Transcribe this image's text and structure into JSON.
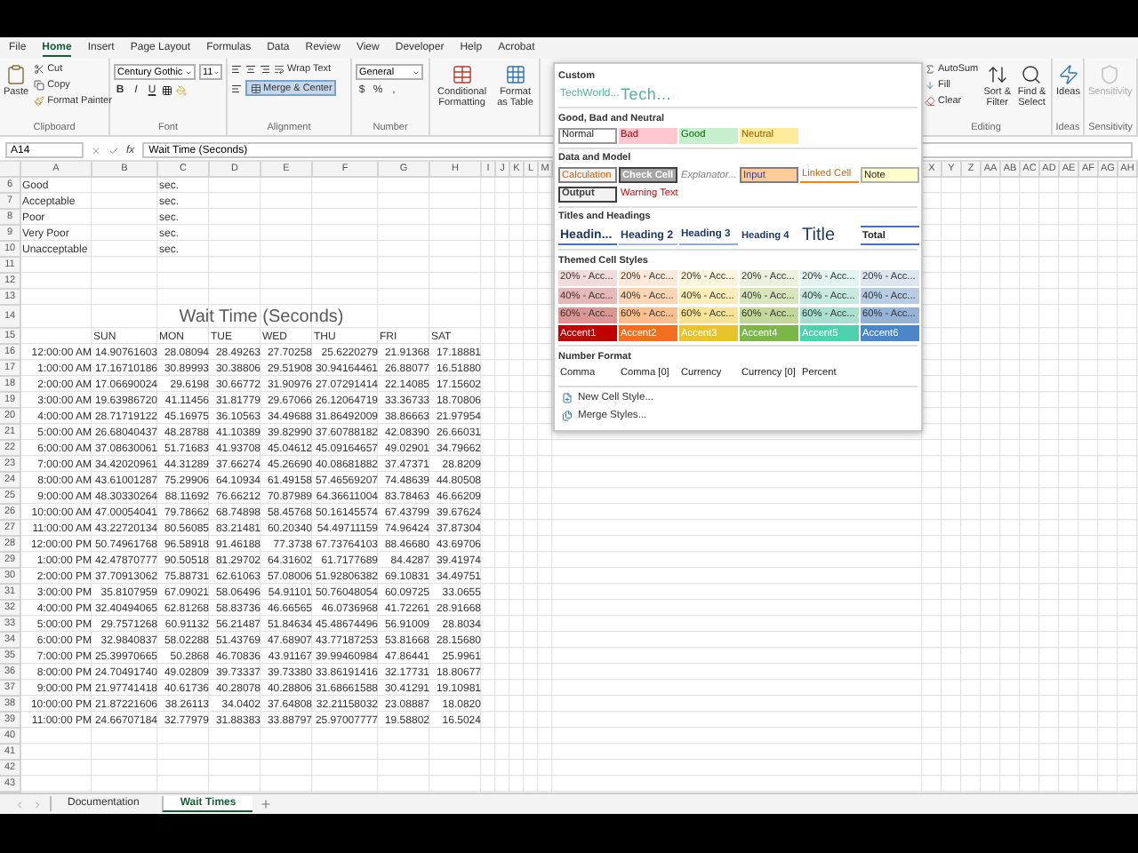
{
  "ribbon_tabs": [
    {
      "label": "File",
      "selected": false
    },
    {
      "label": "Home",
      "selected": true
    },
    {
      "label": "Insert",
      "selected": false
    },
    {
      "label": "Page Layout",
      "selected": false
    },
    {
      "label": "Formulas",
      "selected": false
    },
    {
      "label": "Data",
      "selected": false
    },
    {
      "label": "Review",
      "selected": false
    },
    {
      "label": "View",
      "selected": false
    },
    {
      "label": "Developer",
      "selected": false
    },
    {
      "label": "Help",
      "selected": false
    },
    {
      "label": "Acrobat",
      "selected": false
    }
  ],
  "ribbon": {
    "clipboard": {
      "label": "Clipboard",
      "paste": "Paste",
      "cut": "Cut",
      "copy": "Copy",
      "format_painter": "Format Painter"
    },
    "font": {
      "label": "Font",
      "name": "Century Gothic",
      "size": "11",
      "bold": "B",
      "italic": "I",
      "underline": "U"
    },
    "alignment": {
      "label": "Alignment",
      "wrap": "Wrap Text",
      "merge": "Merge & Center",
      "merge_on": true
    },
    "number": {
      "label": "Number",
      "format": "General",
      "currency": "$",
      "percent": "%",
      "comma": ","
    },
    "styles": [
      "Conditional Formatting",
      "Format as Table"
    ],
    "editing": {
      "label": "Editing",
      "autosum": "AutoSum",
      "fill": "Fill",
      "clear": "Clear",
      "sort": "Sort & Filter",
      "find": "Find & Select"
    },
    "ideas": {
      "label": "Ideas",
      "button": "Ideas"
    },
    "sensitivity": {
      "label": "Sensitivity",
      "button": "Sensitivity",
      "disabled": true
    }
  },
  "formula_bar": {
    "name_box": "A14",
    "fx": "fx",
    "formula": "Wait Time (Seconds)"
  },
  "columns_left": [
    "A",
    "B",
    "C",
    "D",
    "E",
    "F",
    "G",
    "H",
    "I",
    "J",
    "K",
    "L",
    "M"
  ],
  "columns_right": [
    "X",
    "Y",
    "Z",
    "AA",
    "AB",
    "AC",
    "AD",
    "AE",
    "AF",
    "AG",
    "AH"
  ],
  "rows": [
    {
      "number": "6",
      "kind": "rating",
      "label": "Good",
      "unit": "sec."
    },
    {
      "number": "7",
      "kind": "rating",
      "label": "Acceptable",
      "unit": "sec."
    },
    {
      "number": "8",
      "kind": "rating",
      "label": "Poor",
      "unit": "sec."
    },
    {
      "number": "9",
      "kind": "rating",
      "label": "Very Poor",
      "unit": "sec."
    },
    {
      "number": "10",
      "kind": "rating",
      "label": "Unacceptable",
      "unit": "sec."
    },
    {
      "number": "11",
      "kind": "empty"
    },
    {
      "number": "12",
      "kind": "empty"
    },
    {
      "number": "13",
      "kind": "empty"
    },
    {
      "number": "14",
      "kind": "title",
      "title": "Wait Time (Seconds)"
    },
    {
      "number": "15",
      "kind": "header",
      "headers": [
        "SUN",
        "MON",
        "TUE",
        "WED",
        "THU",
        "FRI",
        "SAT"
      ]
    },
    {
      "number": "16",
      "kind": "data",
      "time": "12:00:00 AM",
      "values": [
        "14.90761603",
        "28.08094",
        "28.49263",
        "27.70258",
        "25.6220279",
        "21.91368",
        "17.18881"
      ]
    },
    {
      "number": "17",
      "kind": "data",
      "time": "1:00:00 AM",
      "values": [
        "17.16710186",
        "30.89993",
        "30.38806",
        "29.51908",
        "30.94164461",
        "26.88077",
        "16.51880"
      ]
    },
    {
      "number": "18",
      "kind": "data",
      "time": "2:00:00 AM",
      "values": [
        "17.06690024",
        "29.6198",
        "30.66772",
        "31.90976",
        "27.07291414",
        "22.14085",
        "17.15602"
      ]
    },
    {
      "number": "19",
      "kind": "data",
      "time": "3:00:00 AM",
      "values": [
        "19.63986720",
        "41.11456",
        "31.81779",
        "29.67066",
        "26.12064719",
        "33.36733",
        "18.70806"
      ]
    },
    {
      "number": "20",
      "kind": "data",
      "time": "4:00:00 AM",
      "values": [
        "28.71719122",
        "45.16975",
        "36.10563",
        "34.49688",
        "31.86492009",
        "38.86663",
        "21.97954"
      ]
    },
    {
      "number": "21",
      "kind": "data",
      "time": "5:00:00 AM",
      "values": [
        "26.68040437",
        "48.28788",
        "41.10389",
        "39.82990",
        "37.60788182",
        "42.08390",
        "26.66031"
      ]
    },
    {
      "number": "22",
      "kind": "data",
      "time": "6:00:00 AM",
      "values": [
        "37.08630061",
        "51.71683",
        "41.93708",
        "45.04612",
        "45.09164657",
        "49.02901",
        "34.79662"
      ]
    },
    {
      "number": "23",
      "kind": "data",
      "time": "7:00:00 AM",
      "values": [
        "34.42020961",
        "44.31289",
        "37.66274",
        "45.26690",
        "40.08681882",
        "37.47371",
        "28.8209"
      ]
    },
    {
      "number": "24",
      "kind": "data",
      "time": "8:00:00 AM",
      "values": [
        "43.61001287",
        "75.29906",
        "64.10934",
        "61.49158",
        "57.46569207",
        "74.48639",
        "44.80508"
      ]
    },
    {
      "number": "25",
      "kind": "data",
      "time": "9:00:00 AM",
      "values": [
        "48.30330264",
        "88.11692",
        "76.66212",
        "70.87989",
        "64.36611004",
        "83.78463",
        "46.66209"
      ]
    },
    {
      "number": "26",
      "kind": "data",
      "time": "10:00:00 AM",
      "values": [
        "47.00054041",
        "79.78662",
        "68.74898",
        "58.45768",
        "50.16145574",
        "67.43799",
        "39.67624"
      ]
    },
    {
      "number": "27",
      "kind": "data",
      "time": "11:00:00 AM",
      "values": [
        "43.22720134",
        "80.56085",
        "83.21481",
        "60.20340",
        "54.49711159",
        "74.96424",
        "37.87304"
      ]
    },
    {
      "number": "28",
      "kind": "data",
      "time": "12:00:00 PM",
      "values": [
        "50.74961768",
        "96.58918",
        "91.46188",
        "77.3738",
        "67.73764103",
        "88.46680",
        "43.69706"
      ]
    },
    {
      "number": "29",
      "kind": "data",
      "time": "1:00:00 PM",
      "values": [
        "42.47870777",
        "90.50518",
        "81.29702",
        "64.31602",
        "61.7177689",
        "84.4287",
        "39.41974"
      ]
    },
    {
      "number": "30",
      "kind": "data",
      "time": "2:00:00 PM",
      "values": [
        "37.70913062",
        "75.88731",
        "62.61063",
        "57.08006",
        "51.92806382",
        "69.10831",
        "34.49751"
      ]
    },
    {
      "number": "31",
      "kind": "data",
      "time": "3:00:00 PM",
      "values": [
        "35.8107959",
        "67.09021",
        "58.06496",
        "54.91101",
        "50.76048054",
        "60.09725",
        "33.0655"
      ]
    },
    {
      "number": "32",
      "kind": "data",
      "time": "4:00:00 PM",
      "values": [
        "32.40494065",
        "62.81268",
        "58.83736",
        "46.66565",
        "46.0736968",
        "41.72261",
        "28.91668"
      ]
    },
    {
      "number": "33",
      "kind": "data",
      "time": "5:00:00 PM",
      "values": [
        "29.7571268",
        "60.91132",
        "56.21487",
        "51.84634",
        "45.48674496",
        "56.91009",
        "28.8034"
      ]
    },
    {
      "number": "34",
      "kind": "data",
      "time": "6:00:00 PM",
      "values": [
        "32.9840837",
        "58.02288",
        "51.43769",
        "47.68907",
        "43.77187253",
        "53.81668",
        "28.15680"
      ]
    },
    {
      "number": "35",
      "kind": "data",
      "time": "7:00:00 PM",
      "values": [
        "25.39970665",
        "50.2868",
        "46.70836",
        "43.91167",
        "39.99460984",
        "47.86441",
        "25.9961"
      ]
    },
    {
      "number": "36",
      "kind": "data",
      "time": "8:00:00 PM",
      "values": [
        "24.70491740",
        "49.02809",
        "39.73337",
        "39.73380",
        "33.86191416",
        "32.17731",
        "18.80677"
      ]
    },
    {
      "number": "37",
      "kind": "data",
      "time": "9:00:00 PM",
      "values": [
        "21.97741418",
        "40.61736",
        "40.28078",
        "40.28806",
        "31.68661588",
        "30.41291",
        "19.10981"
      ]
    },
    {
      "number": "38",
      "kind": "data",
      "time": "10:00:00 PM",
      "values": [
        "21.87221606",
        "38.26113",
        "34.0402",
        "37.64808",
        "32.21158032",
        "23.08887",
        "18.0820"
      ]
    },
    {
      "number": "39",
      "kind": "data",
      "time": "11:00:00 PM",
      "values": [
        "24.66707184",
        "32.77979",
        "31.88383",
        "33.88797",
        "25.97007777",
        "19.58802",
        "16.5024"
      ]
    },
    {
      "number": "40",
      "kind": "empty"
    },
    {
      "number": "41",
      "kind": "empty"
    },
    {
      "number": "42",
      "kind": "empty"
    },
    {
      "number": "43",
      "kind": "empty"
    }
  ],
  "sheet_tabs": [
    {
      "label": "Documentation",
      "selected": false
    },
    {
      "label": "Wait Times",
      "selected": true
    }
  ],
  "cell_styles": {
    "sections": [
      {
        "title": "Custom",
        "styles": [
          {
            "label": "TechWorld...",
            "kind": "custom_small"
          },
          {
            "label": "Tech...",
            "kind": "custom_large"
          }
        ]
      },
      {
        "title": "Good, Bad and Neutral",
        "styles": [
          {
            "label": "Normal",
            "kind": "normal"
          },
          {
            "label": "Bad",
            "kind": "bad"
          },
          {
            "label": "Good",
            "kind": "good"
          },
          {
            "label": "Neutral",
            "kind": "neutral"
          }
        ]
      },
      {
        "title": "Data and Model",
        "styles": [
          {
            "label": "Calculation",
            "kind": "calculation"
          },
          {
            "label": "Check Cell",
            "kind": "check"
          },
          {
            "label": "Explanator...",
            "kind": "explanatory"
          },
          {
            "label": "Input",
            "kind": "input"
          },
          {
            "label": "Linked Cell",
            "kind": "linked"
          },
          {
            "label": "Note",
            "kind": "note"
          },
          {
            "label": "Output",
            "kind": "output"
          },
          {
            "label": "Warning Text",
            "kind": "warning"
          }
        ]
      },
      {
        "title": "Titles and Headings",
        "styles": [
          {
            "label": "Headin...",
            "kind": "heading1"
          },
          {
            "label": "Heading 2",
            "kind": "heading2"
          },
          {
            "label": "Heading 3",
            "kind": "heading3"
          },
          {
            "label": "Heading 4",
            "kind": "heading4"
          },
          {
            "label": "Title",
            "kind": "title"
          },
          {
            "label": "Total",
            "kind": "total"
          }
        ]
      },
      {
        "title": "Themed Cell Styles",
        "styles": [
          {
            "label": "20% - Acc...",
            "kind": "tint",
            "color": "#f2dcdb"
          },
          {
            "label": "20% - Acc...",
            "kind": "tint",
            "color": "#fde9d9"
          },
          {
            "label": "20% - Acc...",
            "kind": "tint",
            "color": "#fdf6dc"
          },
          {
            "label": "20% - Acc...",
            "kind": "tint",
            "color": "#ebf1de"
          },
          {
            "label": "20% - Acc...",
            "kind": "tint",
            "color": "#e2f4ef"
          },
          {
            "label": "20% - Acc...",
            "kind": "tint",
            "color": "#dce6f1"
          },
          {
            "label": "40% - Acc...",
            "kind": "tint",
            "color": "#e6b8b7"
          },
          {
            "label": "40% - Acc...",
            "kind": "tint",
            "color": "#fcd5b4"
          },
          {
            "label": "40% - Acc...",
            "kind": "tint",
            "color": "#fbedb8"
          },
          {
            "label": "40% - Acc...",
            "kind": "tint",
            "color": "#d8e4bc"
          },
          {
            "label": "40% - Acc...",
            "kind": "tint",
            "color": "#c5e9df"
          },
          {
            "label": "40% - Acc...",
            "kind": "tint",
            "color": "#b8cce4"
          },
          {
            "label": "60% - Acc...",
            "kind": "tint",
            "color": "#da9694"
          },
          {
            "label": "60% - Acc...",
            "kind": "tint",
            "color": "#fabf8f"
          },
          {
            "label": "60% - Acc...",
            "kind": "tint",
            "color": "#f8e395"
          },
          {
            "label": "60% - Acc...",
            "kind": "tint",
            "color": "#c4d79b"
          },
          {
            "label": "60% - Acc...",
            "kind": "tint",
            "color": "#a8dfcf"
          },
          {
            "label": "60% - Acc...",
            "kind": "tint",
            "color": "#95b3d7"
          },
          {
            "label": "Accent1",
            "kind": "accent",
            "color": "#c00000"
          },
          {
            "label": "Accent2",
            "kind": "accent",
            "color": "#f07020"
          },
          {
            "label": "Accent3",
            "kind": "accent",
            "color": "#e8c32c"
          },
          {
            "label": "Accent4",
            "kind": "accent",
            "color": "#7ab648"
          },
          {
            "label": "Accent5",
            "kind": "accent",
            "color": "#4fd1ae"
          },
          {
            "label": "Accent6",
            "kind": "accent",
            "color": "#4a86c8"
          }
        ]
      },
      {
        "title": "Number Format",
        "styles": [
          {
            "label": "Comma",
            "kind": "plain"
          },
          {
            "label": "Comma [0]",
            "kind": "plain"
          },
          {
            "label": "Currency",
            "kind": "plain"
          },
          {
            "label": "Currency [0]",
            "kind": "plain"
          },
          {
            "label": "Percent",
            "kind": "plain"
          }
        ]
      }
    ],
    "actions": [
      "New Cell Style...",
      "Merge Styles..."
    ]
  }
}
